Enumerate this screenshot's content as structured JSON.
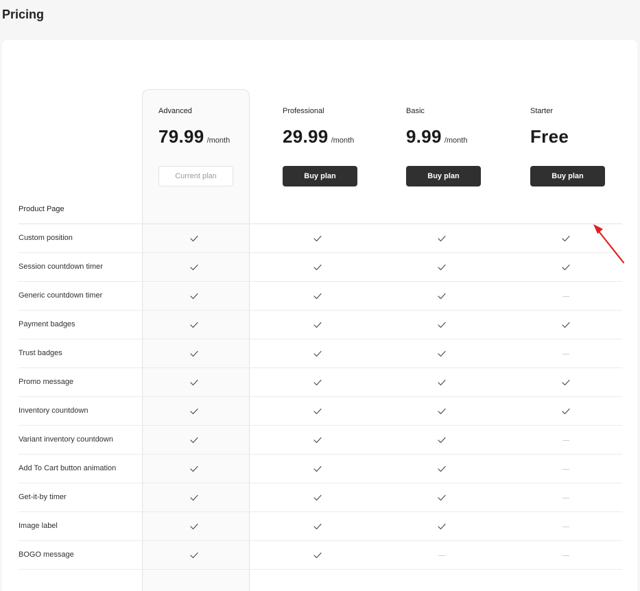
{
  "page": {
    "title": "Pricing"
  },
  "plans": [
    {
      "name": "Advanced",
      "price": "79.99",
      "per": "/month",
      "button": "Current plan",
      "current": true
    },
    {
      "name": "Professional",
      "price": "29.99",
      "per": "/month",
      "button": "Buy plan",
      "current": false
    },
    {
      "name": "Basic",
      "price": "9.99",
      "per": "/month",
      "button": "Buy plan",
      "current": false
    },
    {
      "name": "Starter",
      "price": "Free",
      "per": "",
      "button": "Buy plan",
      "current": false
    }
  ],
  "section": {
    "title": "Product Page"
  },
  "features": [
    {
      "name": "Custom position",
      "availability": [
        true,
        true,
        true,
        true
      ]
    },
    {
      "name": "Session countdown timer",
      "availability": [
        true,
        true,
        true,
        true
      ]
    },
    {
      "name": "Generic countdown timer",
      "availability": [
        true,
        true,
        true,
        false
      ]
    },
    {
      "name": "Payment badges",
      "availability": [
        true,
        true,
        true,
        true
      ]
    },
    {
      "name": "Trust badges",
      "availability": [
        true,
        true,
        true,
        false
      ]
    },
    {
      "name": "Promo message",
      "availability": [
        true,
        true,
        true,
        true
      ]
    },
    {
      "name": "Inventory countdown",
      "availability": [
        true,
        true,
        true,
        true
      ]
    },
    {
      "name": "Variant inventory countdown",
      "availability": [
        true,
        true,
        true,
        false
      ]
    },
    {
      "name": "Add To Cart button animation",
      "availability": [
        true,
        true,
        true,
        false
      ]
    },
    {
      "name": "Get-it-by timer",
      "availability": [
        true,
        true,
        true,
        false
      ]
    },
    {
      "name": "Image label",
      "availability": [
        true,
        true,
        true,
        false
      ]
    },
    {
      "name": "BOGO message",
      "availability": [
        true,
        true,
        false,
        false
      ]
    }
  ],
  "colors": {
    "accent_dark": "#303030",
    "annotation_arrow": "#e02020"
  }
}
